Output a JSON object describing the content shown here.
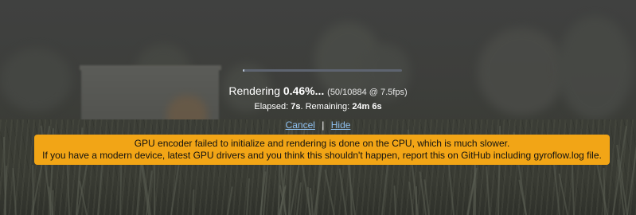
{
  "render": {
    "label": "Rendering",
    "percent": "0.46%",
    "percent_suffix": "...",
    "frames": "(50/10884 @ 7.5fps)",
    "progress_fraction": 0.0046,
    "elapsed_label": "Elapsed:",
    "elapsed_value": "7s",
    "remaining_label": ". Remaining:",
    "remaining_value": "24m 6s",
    "cancel_label": "Cancel",
    "separator": "|",
    "hide_label": "Hide"
  },
  "warning": {
    "line1": "GPU encoder failed to initialize and rendering is done on the CPU, which is much slower.",
    "line2": "If you have a modern device, latest GPU drivers and you think this shouldn't happen, report this on GitHub including gyroflow.log file."
  },
  "colors": {
    "warning_bg": "#f2a516",
    "link": "#8fc1f0",
    "progress_fill": "#b9c6d6",
    "progress_track": "#5e6470"
  }
}
